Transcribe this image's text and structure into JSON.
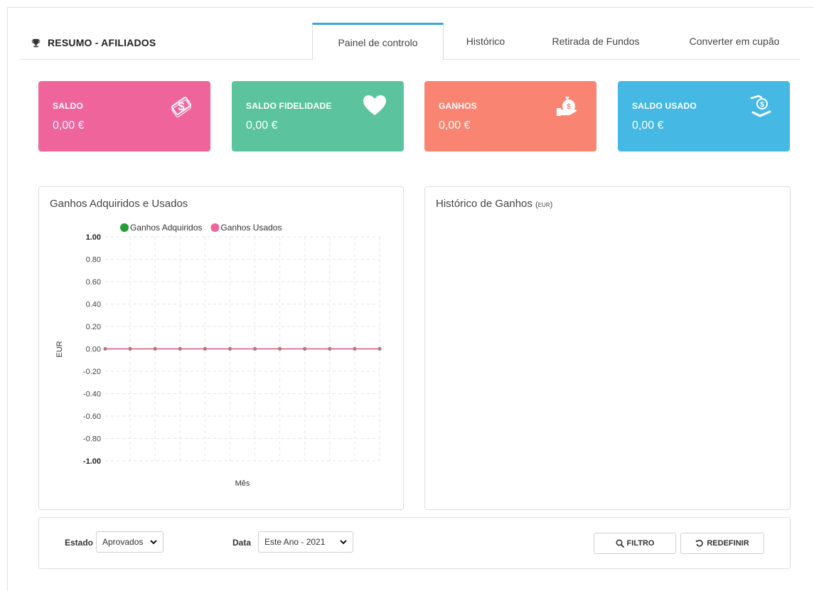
{
  "header": {
    "title": "RESUMO - AFILIADOS",
    "tabs": [
      "Painel de controlo",
      "Histórico",
      "Retirada de Fundos",
      "Converter em cupão"
    ],
    "active_tab": "Painel de controlo"
  },
  "cards": [
    {
      "label": "SALDO",
      "value": "0,00 €",
      "icon": "money-icon",
      "color": "#f0649c"
    },
    {
      "label": "SALDO FIDELIDADE",
      "value": "0,00 €",
      "icon": "heart-icon",
      "color": "#5bc49f"
    },
    {
      "label": "GANHOS",
      "value": "0,00 €",
      "icon": "money-bag-hand-icon",
      "color": "#f98471"
    },
    {
      "label": "SALDO USADO",
      "value": "0,00 €",
      "icon": "hand-coin-icon",
      "color": "#45b8e3"
    }
  ],
  "panels": {
    "left_title": "Ganhos Adquiridos e Usados",
    "right_title": "Histórico de Ganhos",
    "right_unit": "(EUR)"
  },
  "chart_data": {
    "type": "line",
    "title": "Ganhos Adquiridos e Usados",
    "xlabel": "Mês",
    "ylabel": "EUR",
    "ylim": [
      -1,
      1
    ],
    "yticks": [
      "1.00",
      "0.80",
      "0.60",
      "0.40",
      "0.20",
      "0.00",
      "-0.20",
      "-0.40",
      "-0.60",
      "-0.80",
      "-1.00"
    ],
    "x": [
      1,
      2,
      3,
      4,
      5,
      6,
      7,
      8,
      9,
      10,
      11,
      12
    ],
    "series": [
      {
        "name": "Ganhos Adquiridos",
        "color": "#22a033",
        "values": [
          0,
          0,
          0,
          0,
          0,
          0,
          0,
          0,
          0,
          0,
          0,
          0
        ]
      },
      {
        "name": "Ganhos Usados",
        "color": "#f0649c",
        "values": [
          0,
          0,
          0,
          0,
          0,
          0,
          0,
          0,
          0,
          0,
          0,
          0
        ]
      }
    ],
    "grid": true,
    "legend": "top"
  },
  "filters": {
    "estado_label": "Estado",
    "estado_value": "Aprovados",
    "data_label": "Data",
    "data_value": "Este Ano - 2021",
    "filter_button": "FILTRO",
    "reset_button": "REDEFINIR"
  }
}
